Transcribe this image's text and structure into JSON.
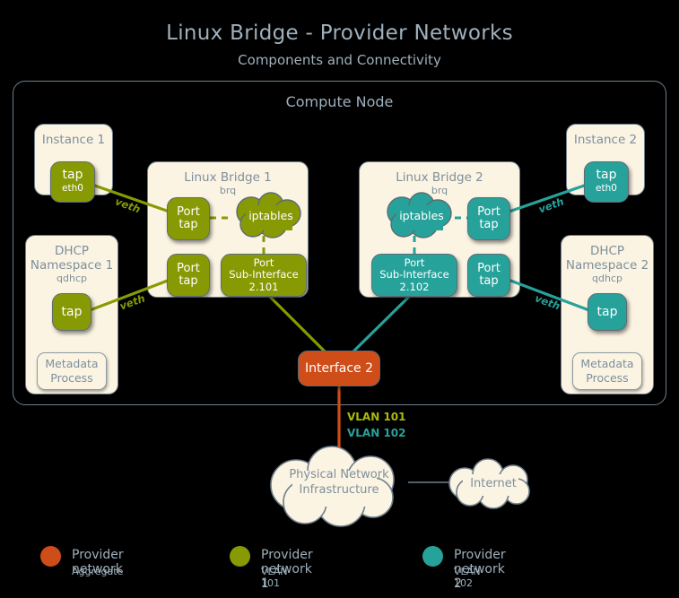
{
  "title": "Linux Bridge - Provider Networks",
  "subtitle": "Components and Connectivity",
  "compute_node": {
    "label": "Compute Node"
  },
  "colors": {
    "aggregate_orange": "#ce4d18",
    "network1_olive": "#879a04",
    "network2_teal": "#26a29b",
    "cream": "#fcf4e3",
    "border_grey": "#6e7f8c",
    "text_grey": "#9fb0bc",
    "background": "#000000"
  },
  "instance1": {
    "title": "Instance 1",
    "tap": {
      "line1": "tap",
      "line2": "eth0"
    },
    "veth_label": "veth"
  },
  "instance2": {
    "title": "Instance 2",
    "tap": {
      "line1": "tap",
      "line2": "eth0"
    },
    "veth_label": "veth"
  },
  "dhcp1": {
    "title_line1": "DHCP",
    "title_line2": "Namespace 1",
    "subtitle": "qdhcp",
    "tap": {
      "line1": "tap"
    },
    "metadata": {
      "line1": "Metadata",
      "line2": "Process"
    },
    "veth_label": "veth"
  },
  "dhcp2": {
    "title_line1": "DHCP",
    "title_line2": "Namespace 2",
    "subtitle": "qdhcp",
    "tap": {
      "line1": "tap"
    },
    "metadata": {
      "line1": "Metadata",
      "line2": "Process"
    },
    "veth_label": "veth"
  },
  "bridge1": {
    "title": "Linux Bridge 1",
    "subtitle": "brq",
    "port_tap_top": {
      "line1": "Port",
      "line2": "tap"
    },
    "port_tap_bottom": {
      "line1": "Port",
      "line2": "tap"
    },
    "iptables": "iptables",
    "port_subinterface": {
      "line1": "Port",
      "line2": "Sub-Interface",
      "line3": "2.101"
    }
  },
  "bridge2": {
    "title": "Linux Bridge 2",
    "subtitle": "brq",
    "port_tap_top": {
      "line1": "Port",
      "line2": "tap"
    },
    "port_tap_bottom": {
      "line1": "Port",
      "line2": "tap"
    },
    "iptables": "iptables",
    "port_subinterface": {
      "line1": "Port",
      "line2": "Sub-Interface",
      "line3": "2.102"
    }
  },
  "interface": {
    "label": "Interface 2"
  },
  "vlan_labels": {
    "vlan1": "VLAN 101",
    "vlan2": "VLAN 102"
  },
  "physical_network": {
    "line1": "Physical Network",
    "line2": "Infrastructure"
  },
  "internet": {
    "label": "Internet"
  },
  "legend": {
    "items": [
      {
        "title": "Provider network",
        "subtitle": "Aggregate",
        "color": "#ce4d18"
      },
      {
        "title": "Provider network 1",
        "subtitle": "VLAN 101",
        "color": "#879a04"
      },
      {
        "title": "Provider network 2",
        "subtitle": "VLAN 102",
        "color": "#26a29b"
      }
    ]
  }
}
